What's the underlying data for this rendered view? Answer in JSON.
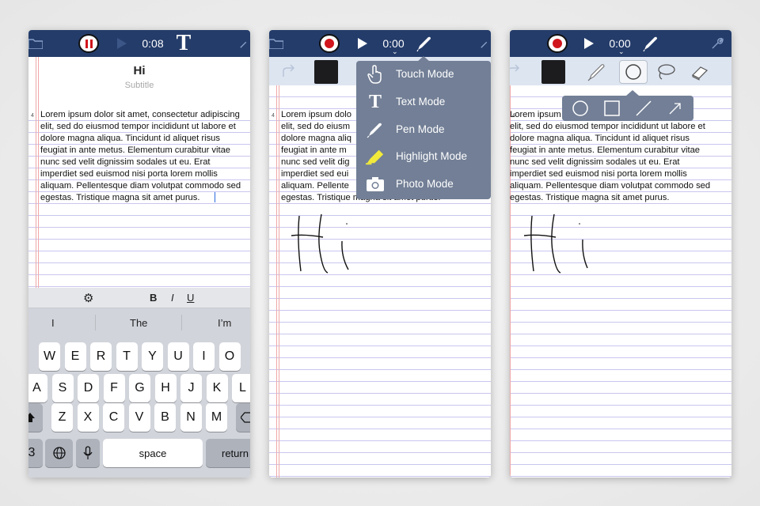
{
  "phone1": {
    "time": "0:08",
    "text_mode_glyph": "T",
    "title": "Hi",
    "subtitle": "Subtitle",
    "line_marker": "4",
    "body_lines": [
      "Lorem ipsum dolor sit amet, consectetur adipiscing",
      "elit, sed do eiusmod tempor incididunt ut labore et",
      "dolore magna aliqua. Tincidunt id aliquet risus",
      "feugiat in ante metus. Elementum curabitur vitae",
      "nunc sed velit dignissim sodales ut eu. Erat",
      "imperdiet sed euismod nisi porta lorem mollis",
      "aliquam. Pellentesque diam volutpat commodo sed",
      "egestas. Tristique magna sit amet purus."
    ],
    "format_bar": {
      "bold": "B",
      "italic": "I",
      "underline": "U"
    },
    "suggestions": [
      "I",
      "The",
      "I’m"
    ],
    "keyboard": {
      "row1": [
        "W",
        "E",
        "R",
        "T",
        "Y",
        "U",
        "I",
        "O"
      ],
      "row2": [
        "A",
        "S",
        "D",
        "F",
        "G",
        "H",
        "J",
        "K",
        "L"
      ],
      "row3": [
        "Z",
        "X",
        "C",
        "V",
        "B",
        "N",
        "M"
      ],
      "numbers_key": "3",
      "space": "space",
      "return": "return"
    }
  },
  "phone2": {
    "time": "0:00",
    "line_marker": "4",
    "body_lines": [
      "Lorem ipsum dolo",
      "elit, sed do eiusm",
      "dolore magna aliq",
      "feugiat in ante m",
      "nunc sed velit dig",
      "imperdiet sed eui",
      "aliquam. Pellente",
      "egestas. Tristique magna sit amet purus."
    ],
    "mode_menu": [
      {
        "label": "Touch Mode",
        "icon": "hand-pointer-icon"
      },
      {
        "label": "Text Mode",
        "icon": "text-t-icon"
      },
      {
        "label": "Pen Mode",
        "icon": "pen-icon"
      },
      {
        "label": "Highlight Mode",
        "icon": "highlighter-icon"
      },
      {
        "label": "Photo Mode",
        "icon": "camera-icon"
      }
    ],
    "highlight_color": "#f2ea3a"
  },
  "phone3": {
    "time": "0:00",
    "line_marker": "4",
    "body_lines": [
      "Lorem ipsum",
      "elit, sed do eiusmod tempor incididunt ut labore et",
      "dolore magna aliqua. Tincidunt id aliquet risus",
      "feugiat in ante metus. Elementum curabitur vitae",
      "nunc sed velit dignissim sodales ut eu. Erat",
      "imperdiet sed euismod nisi porta lorem mollis",
      "aliquam. Pellentesque diam volutpat commodo sed",
      "egestas. Tristique magna sit amet purus."
    ],
    "tools": [
      "pen-icon",
      "shape-circle-icon",
      "lasso-icon",
      "eraser-icon"
    ],
    "shapes": [
      "circle-icon",
      "square-icon",
      "line-icon",
      "arrow-icon"
    ]
  },
  "colors": {
    "navbar": "#243c6a",
    "record_red": "#d0151c",
    "popup": "#727f96",
    "rule_line": "#c9c6ef",
    "margin_line": "#f0a8a8"
  }
}
